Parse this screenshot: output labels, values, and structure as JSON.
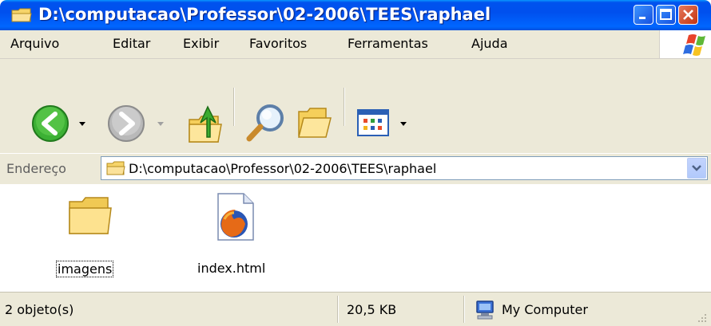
{
  "window": {
    "title": "D:\\computacao\\Professor\\02-2006\\TEES\\raphael"
  },
  "menu": {
    "items": [
      "Arquivo",
      "Editar",
      "Exibir",
      "Favoritos",
      "Ferramentas",
      "Ajuda"
    ]
  },
  "address": {
    "label": "Endereço",
    "value": "D:\\computacao\\Professor\\02-2006\\TEES\\raphael"
  },
  "files": [
    {
      "name": "imagens",
      "icon": "folder-icon",
      "selected": true
    },
    {
      "name": "index.html",
      "icon": "firefox-document-icon",
      "selected": false
    }
  ],
  "status": {
    "objects": "2 objeto(s)",
    "size": "20,5 KB",
    "location": "My Computer"
  },
  "colors": {
    "titlebar": "#0054e3",
    "chrome": "#ece9d8",
    "back_green": "#3cb034",
    "close_red": "#d2401b"
  }
}
